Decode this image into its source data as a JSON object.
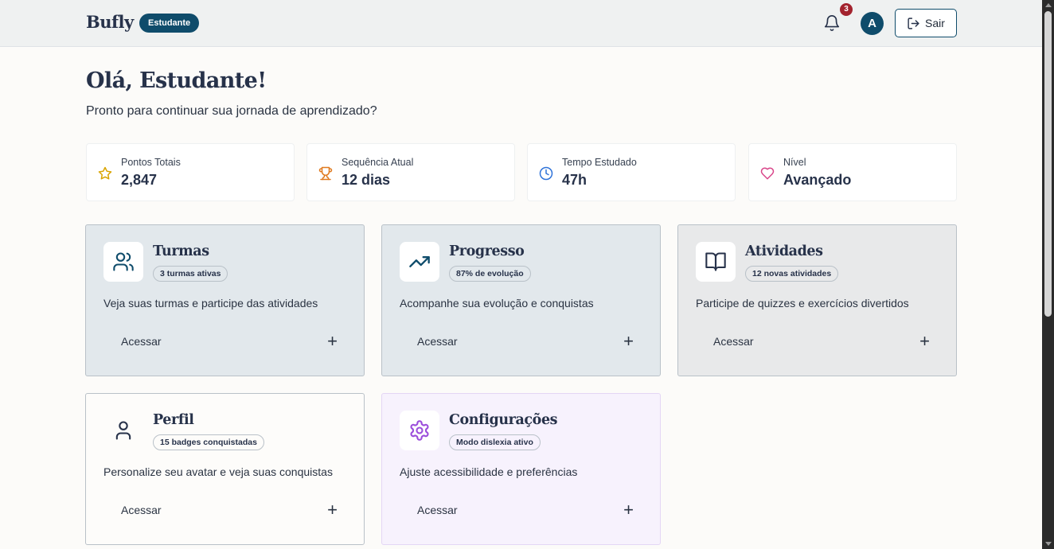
{
  "header": {
    "brand": "Bufly",
    "role_badge": "Estudante",
    "notification_count": "3",
    "avatar_initial": "A",
    "logout_label": "Sair"
  },
  "hero": {
    "greeting": "Olá, Estudante!",
    "subtitle": "Pronto para continuar sua jornada de aprendizado?"
  },
  "stats": [
    {
      "label": "Pontos Totais",
      "value": "2,847",
      "icon": "star-icon",
      "color": "#d9a400"
    },
    {
      "label": "Sequência Atual",
      "value": "12 dias",
      "icon": "trophy-icon",
      "color": "#e07a1f"
    },
    {
      "label": "Tempo Estudado",
      "value": "47h",
      "icon": "clock-icon",
      "color": "#2f73d9"
    },
    {
      "label": "Nível",
      "value": "Avançado",
      "icon": "heart-icon",
      "color": "#d9468a"
    }
  ],
  "cards": [
    {
      "title": "Turmas",
      "badge": "3 turmas ativas",
      "description": "Veja suas turmas e participe das atividades",
      "action": "Acessar",
      "icon": "users-icon",
      "bg": "#e2e8ec"
    },
    {
      "title": "Progresso",
      "badge": "87% de evolução",
      "description": "Acompanhe sua evolução e conquistas",
      "action": "Acessar",
      "icon": "trending-up-icon",
      "bg": "#e2e8ec"
    },
    {
      "title": "Atividades",
      "badge": "12 novas atividades",
      "description": "Participe de quizzes e exercícios divertidos",
      "action": "Acessar",
      "icon": "book-icon",
      "bg": "#e8e9ea"
    },
    {
      "title": "Perfil",
      "badge": "15 badges conquistadas",
      "description": "Personalize seu avatar e veja suas conquistas",
      "action": "Acessar",
      "icon": "user-icon",
      "bg": "#fdfcfa"
    },
    {
      "title": "Configurações",
      "badge": "Modo dislexia ativo",
      "description": "Ajuste acessibilidade e preferências",
      "action": "Acessar",
      "icon": "gear-icon",
      "bg": "#f7f2fd"
    }
  ]
}
